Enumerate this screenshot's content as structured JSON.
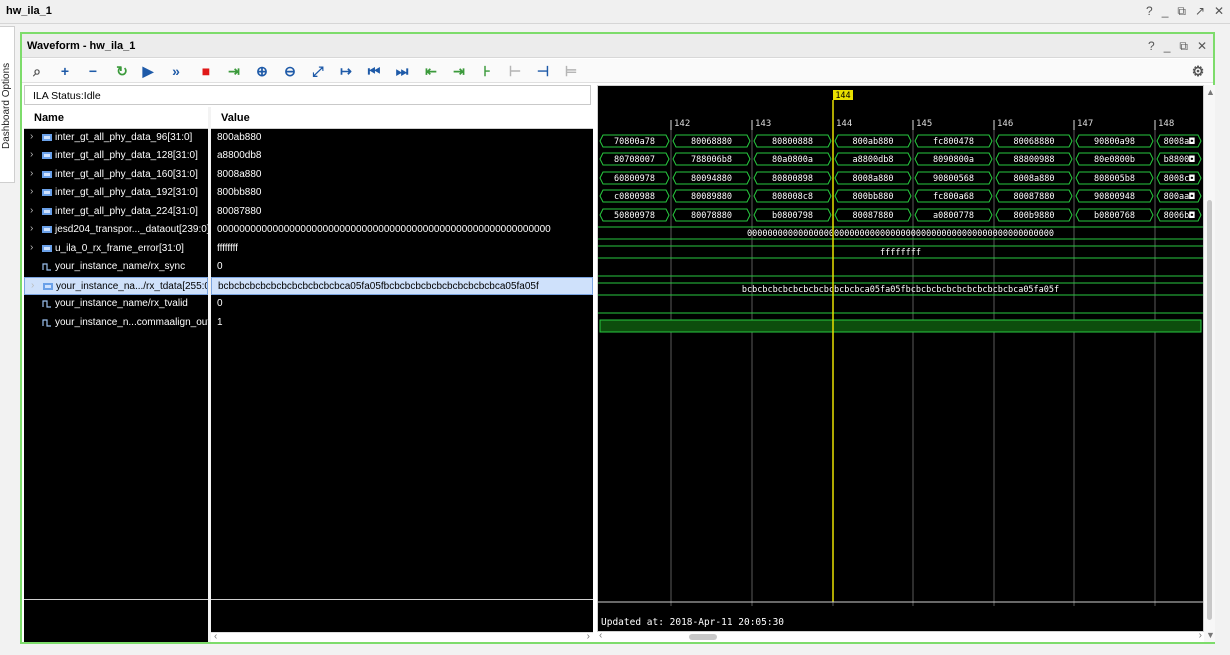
{
  "window": {
    "title": "hw_ila_1",
    "controls": [
      "?",
      "_",
      "⧉",
      "↗",
      "✕"
    ]
  },
  "side_tab": {
    "label": "Dashboard Options"
  },
  "panel": {
    "title": "Waveform - hw_ila_1",
    "controls": [
      "?",
      "_",
      "⧉",
      "✕"
    ]
  },
  "toolbar": {
    "icons": [
      {
        "name": "search-icon",
        "glyph": "⌕",
        "tone": "dark"
      },
      {
        "name": "add-icon",
        "glyph": "+",
        "tone": "blue"
      },
      {
        "name": "remove-icon",
        "glyph": "−",
        "tone": "blue"
      },
      {
        "name": "refresh-icon",
        "glyph": "↻",
        "tone": "green"
      },
      {
        "name": "run-trigger-icon",
        "glyph": "▶",
        "tone": "blue"
      },
      {
        "name": "run-immediate-icon",
        "glyph": "»",
        "tone": "blue"
      },
      {
        "name": "stop-icon",
        "glyph": "■",
        "tone": "red"
      },
      {
        "name": "export-icon",
        "glyph": "⇥",
        "tone": "green"
      },
      {
        "name": "zoom-in-icon",
        "glyph": "⊕",
        "tone": "blue"
      },
      {
        "name": "zoom-out-icon",
        "glyph": "⊖",
        "tone": "blue"
      },
      {
        "name": "zoom-fit-icon",
        "glyph": "⤢",
        "tone": "blue"
      },
      {
        "name": "goto-cursor-icon",
        "glyph": "↦",
        "tone": "blue"
      },
      {
        "name": "goto-start-icon",
        "glyph": "⏮",
        "tone": "blue"
      },
      {
        "name": "goto-end-icon",
        "glyph": "⏭",
        "tone": "blue"
      },
      {
        "name": "prev-transition-icon",
        "glyph": "⇤",
        "tone": "green"
      },
      {
        "name": "next-transition-icon",
        "glyph": "⇥",
        "tone": "green"
      },
      {
        "name": "add-marker-icon",
        "glyph": "⊦",
        "tone": "green"
      },
      {
        "name": "prev-marker-icon",
        "glyph": "⊢",
        "tone": "grey"
      },
      {
        "name": "next-marker-icon",
        "glyph": "⊣",
        "tone": "blue"
      },
      {
        "name": "swap-markers-icon",
        "glyph": "⊨",
        "tone": "grey"
      }
    ],
    "settings_icon": "⚙"
  },
  "ila_status": "ILA Status:Idle",
  "columns": {
    "name": "Name",
    "value": "Value"
  },
  "signals": [
    {
      "name": "inter_gt_all_phy_data_96[31:0]",
      "value": "800ab880",
      "bus": true,
      "selected": false
    },
    {
      "name": "inter_gt_all_phy_data_128[31:0]",
      "value": "a8800db8",
      "bus": true,
      "selected": false
    },
    {
      "name": "inter_gt_all_phy_data_160[31:0]",
      "value": "8008a880",
      "bus": true,
      "selected": false
    },
    {
      "name": "inter_gt_all_phy_data_192[31:0]",
      "value": "800bb880",
      "bus": true,
      "selected": false
    },
    {
      "name": "inter_gt_all_phy_data_224[31:0]",
      "value": "80087880",
      "bus": true,
      "selected": false
    },
    {
      "name": "jesd204_transpor..._dataout[239:0]",
      "value": "000000000000000000000000000000000000000000000000000000000000",
      "bus": true,
      "selected": false
    },
    {
      "name": "u_ila_0_rx_frame_error[31:0]",
      "value": "ffffffff",
      "bus": true,
      "selected": false
    },
    {
      "name": "your_instance_name/rx_sync",
      "value": "0",
      "bus": false,
      "selected": false
    },
    {
      "name": "your_instance_na.../rx_tdata[255:0]",
      "value": "bcbcbcbcbcbcbcbcbcbcbcbca05fa05fbcbcbcbcbcbcbcbcbcbcbca05fa05f",
      "bus": true,
      "selected": true
    },
    {
      "name": "your_instance_name/rx_tvalid",
      "value": "0",
      "bus": false,
      "selected": false
    },
    {
      "name": "your_instance_n...commaalign_out",
      "value": "1",
      "bus": false,
      "selected": false
    }
  ],
  "waveform": {
    "cursor_label": "144",
    "ticks": [
      "142",
      "143",
      "144",
      "145",
      "146",
      "147",
      "148"
    ],
    "bus_rows": [
      [
        "70800a78",
        "80068880",
        "80800888",
        "800ab880",
        "fc800478",
        "80068880",
        "90800a98",
        "8008a◘"
      ],
      [
        "80708007",
        "788006b8",
        "80a0800a",
        "a8800db8",
        "8090800a",
        "88800988",
        "80e0800b",
        "b8800◘"
      ],
      [
        "60800978",
        "80094880",
        "80800898",
        "8008a880",
        "90800568",
        "8008a880",
        "808005b8",
        "8008c◘"
      ],
      [
        "c0800988",
        "80089880",
        "808008c8",
        "800bb880",
        "fc800a68",
        "80087880",
        "90800948",
        "800aa◘"
      ],
      [
        "50800978",
        "80078880",
        "b0800798",
        "80087880",
        "a0800778",
        "800b9880",
        "b0800768",
        "8006b◘"
      ]
    ],
    "dataout_label": "000000000000000000000000000000000000000000000000000000000000",
    "frame_error_label": "ffffffff",
    "tdata_label": "bcbcbcbcbcbcbcbcbcbcbcbca05fa05fbcbcbcbcbcbcbcbcbcbcbca05fa05f",
    "updated": "Updated at: 2018-Apr-11 20:05:30"
  },
  "colors": {
    "wave_green": "#27c93f",
    "cursor_yellow": "#e8e000",
    "frame_green": "#7ddc6b",
    "highlight_band": "#0d4d0d"
  }
}
